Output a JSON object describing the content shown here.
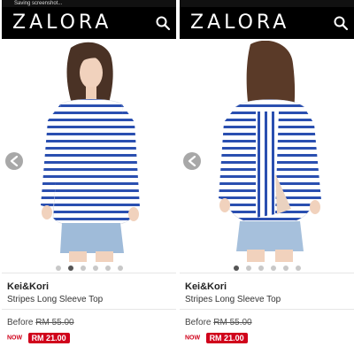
{
  "panels": [
    {
      "status_text": "Saving screenshot...",
      "brand_logo": "ZALORA",
      "icons": {
        "search": "search-icon",
        "prev": "chevron-left-icon"
      },
      "gallery": {
        "total_images": 6,
        "active_index": 1
      },
      "product": {
        "brand": "Kei&Kori",
        "name": "Stripes Long Sleeve Top",
        "before_label": "Before",
        "before_price": "RM 55.00",
        "now_label": "NOW",
        "now_price": "RM 21.00"
      }
    },
    {
      "status_text": "",
      "brand_logo": "ZALORA",
      "icons": {
        "search": "search-icon",
        "prev": "chevron-left-icon"
      },
      "gallery": {
        "total_images": 6,
        "active_index": 0
      },
      "product": {
        "brand": "Kei&Kori",
        "name": "Stripes Long Sleeve Top",
        "before_label": "Before",
        "before_price": "RM 55.00",
        "now_label": "NOW",
        "now_price": "RM 21.00"
      }
    }
  ],
  "colors": {
    "header_bg": "#000000",
    "stripe_blue": "#2a4fb0",
    "sale_red": "#d0021b"
  }
}
